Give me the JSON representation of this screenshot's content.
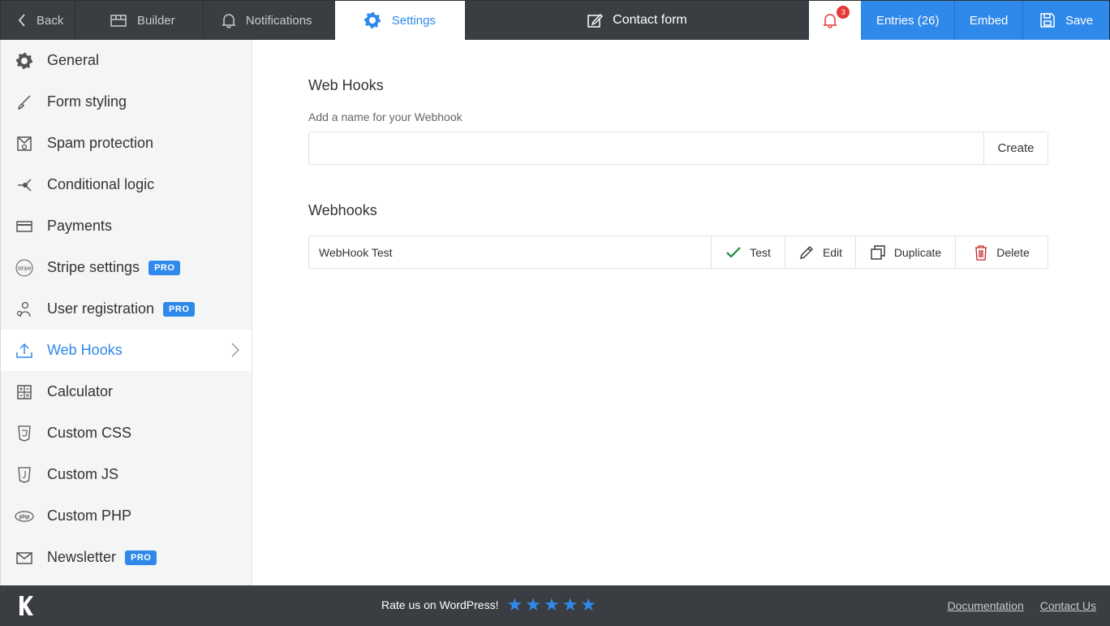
{
  "topbar": {
    "back": "Back",
    "builder": "Builder",
    "notifications": "Notifications",
    "settings": "Settings",
    "form_title": "Contact form",
    "bell_count": "3",
    "entries": "Entries (26)",
    "embed": "Embed",
    "save": "Save"
  },
  "sidebar": {
    "items": [
      {
        "label": "General",
        "icon": "gear-icon"
      },
      {
        "label": "Form styling",
        "icon": "brush-icon"
      },
      {
        "label": "Spam protection",
        "icon": "spam-icon"
      },
      {
        "label": "Conditional logic",
        "icon": "logic-icon"
      },
      {
        "label": "Payments",
        "icon": "card-icon"
      },
      {
        "label": "Stripe settings",
        "icon": "stripe-icon",
        "pro": "PRO"
      },
      {
        "label": "User registration",
        "icon": "user-icon",
        "pro": "PRO"
      },
      {
        "label": "Web Hooks",
        "icon": "upload-icon",
        "active": true
      },
      {
        "label": "Calculator",
        "icon": "calculator-icon"
      },
      {
        "label": "Custom CSS",
        "icon": "css-icon"
      },
      {
        "label": "Custom JS",
        "icon": "js-icon"
      },
      {
        "label": "Custom PHP",
        "icon": "php-icon"
      },
      {
        "label": "Newsletter",
        "icon": "mail-icon",
        "pro": "PRO"
      }
    ]
  },
  "main": {
    "title": "Web Hooks",
    "input_label": "Add a name for your Webhook",
    "input_value": "",
    "create": "Create",
    "list_title": "Webhooks",
    "hooks": [
      {
        "name": "WebHook Test",
        "test": "Test",
        "edit": "Edit",
        "duplicate": "Duplicate",
        "delete": "Delete"
      }
    ]
  },
  "footer": {
    "rate": "Rate us on WordPress!",
    "stars": 5,
    "documentation": "Documentation",
    "contact": "Contact Us"
  },
  "colors": {
    "accent": "#2f89ea",
    "dark": "#3a3d41",
    "danger": "#e53935",
    "success": "#1a8a3a"
  }
}
